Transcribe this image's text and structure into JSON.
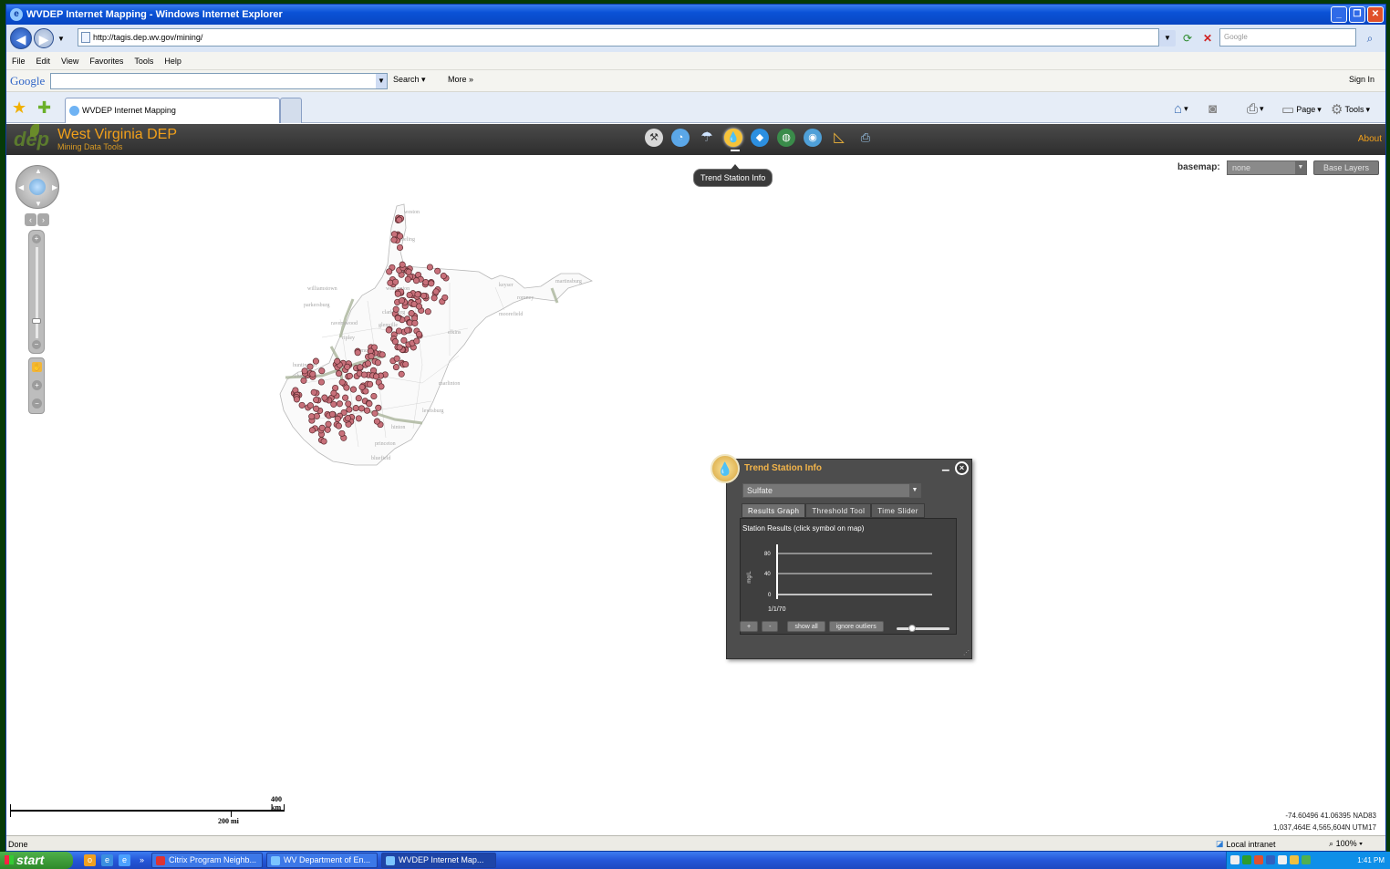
{
  "window": {
    "title": "WVDEP Internet Mapping - Windows Internet Explorer",
    "url": "http://tagis.dep.wv.gov/mining/",
    "search_placeholder": "Google"
  },
  "menu": [
    "File",
    "Edit",
    "View",
    "Favorites",
    "Tools",
    "Help"
  ],
  "google_toolbar": {
    "logo": "Google",
    "search_label": "Search",
    "more_label": "More »",
    "signin_label": "Sign In"
  },
  "tab": {
    "label": "WVDEP Internet Mapping"
  },
  "command_bar": {
    "page_label": "Page",
    "tools_label": "Tools"
  },
  "app": {
    "title": "West Virginia DEP",
    "subtitle": "Mining Data Tools",
    "about_label": "About",
    "tooltip": "Trend Station Info",
    "basemap_label": "basemap:",
    "basemap_value": "none",
    "base_layers_label": "Base Layers"
  },
  "map": {
    "place_labels": [
      "weston",
      "wheeling",
      "williamstown",
      "parkersburg",
      "west union",
      "clarksburg",
      "ravenswood",
      "ripley",
      "glenville",
      "spencer",
      "elkins",
      "moorefield",
      "keyser",
      "romney",
      "martinsburg",
      "huntington",
      "charleston",
      "marlinton",
      "lewisburg",
      "hinton",
      "princeton",
      "bluefield"
    ]
  },
  "panel": {
    "title": "Trend Station Info",
    "parameter": "Sulfate",
    "tabs": [
      "Results Graph",
      "Threshold Tool",
      "Time Slider"
    ],
    "caption": "Station Results (click symbol on map)",
    "y_axis_label": "mg/L",
    "y_ticks": [
      "80",
      "40",
      "0"
    ],
    "x_tick": "1/1/70",
    "buttons": {
      "zoom_in": "+",
      "zoom_out": "-",
      "show_all": "show all",
      "ignore_outliers": "ignore outliers"
    },
    "slider_value": 0.25
  },
  "scale": {
    "km_label": "400 km",
    "mi_label": "200 mi"
  },
  "coords": {
    "line1": "-74.60496 41.06395 NAD83",
    "line2": "1,037,464E 4,565,604N UTM17"
  },
  "status": {
    "left": "Done",
    "zone": "Local intranet",
    "zoom": "100%"
  },
  "taskbar": {
    "start_label": "start",
    "buttons": [
      "Citrix Program Neighb...",
      "WV Department of En...",
      "WVDEP Internet Map..."
    ],
    "clock": "1:41 PM"
  },
  "colors": {
    "app_title": "#f2a01a",
    "station_marker": "#c8707a",
    "panel_bg": "#4d4d4d",
    "titlebar": "#0a52d6"
  }
}
